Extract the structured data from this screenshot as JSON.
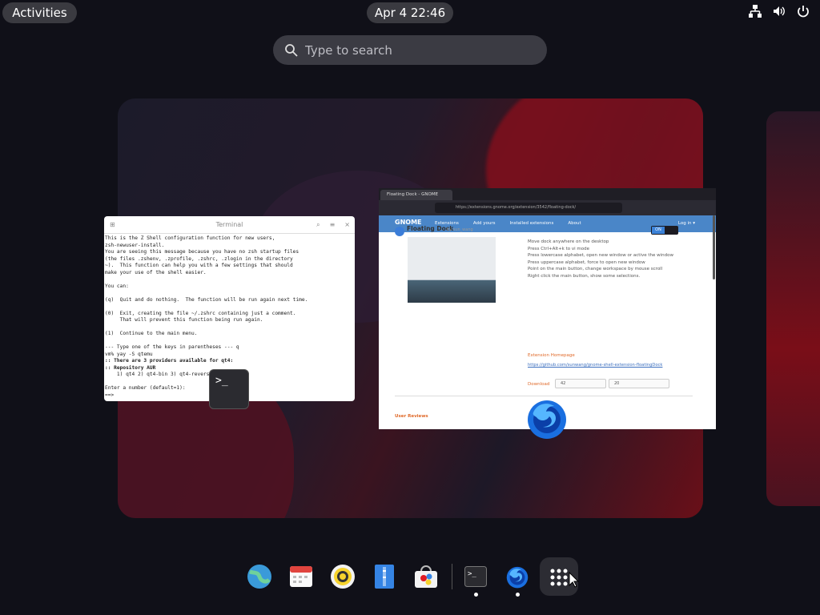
{
  "topbar": {
    "activities_label": "Activities",
    "clock": "Apr 4  22:46",
    "system_icons": [
      "network-icon",
      "volume-icon",
      "power-icon"
    ]
  },
  "search": {
    "placeholder": "Type to search"
  },
  "terminal_window": {
    "title": "Terminal",
    "lines": [
      "This is the Z Shell configuration function for new users,",
      "zsh-newuser-install.",
      "You are seeing this message because you have no zsh startup files",
      "(the files .zshenv, .zprofile, .zshrc, .zlogin in the directory",
      "~).  This function can help you with a few settings that should",
      "make your use of the shell easier.",
      "",
      "You can:",
      "",
      "(q)  Quit and do nothing.  The function will be run again next time.",
      "",
      "(0)  Exit, creating the file ~/.zshrc containing just a comment.",
      "     That will prevent this function being run again.",
      "",
      "(1)  Continue to the main menu.",
      "",
      "--- Type one of the keys in parentheses --- q",
      "vm% yay -S qtemu",
      ":: There are 3 providers available for qt4:",
      ":: Repository AUR",
      "    1) qt4 2) qt4-bin 3) qt4-reversion",
      "",
      "Enter a number (default=1):",
      "==> "
    ]
  },
  "firefox_window": {
    "tab_title": "Floating Dock - GNOME",
    "url": "https://extensions.gnome.org/extension/3542/floating-dock/",
    "site_logo": "GNOME",
    "nav_items": [
      "Extensions",
      "Add yours",
      "Installed extensions",
      "About"
    ],
    "login_label": "Log in ▾",
    "extension_name": "Floating Dock",
    "extension_author": "by sun_wang",
    "toggle_label": "ON",
    "description": [
      "Move dock anywhere on the desktop",
      "",
      "Press Ctrl+Alt+k to vi mode",
      "Press lowercase alphabet, open new window or active the window",
      "Press uppercase alphabet, force to open new window",
      "",
      "Point on the main button, change workspace by mouse scroll",
      "Right click the main button, show some selections."
    ],
    "homepage_label": "Extension Homepage",
    "homepage_url": "https://github.com/sunwang/gnome-shell-extension-floatingDock",
    "download_label": "Download",
    "shell_version": "42",
    "extension_version": "20",
    "reviews_label": "User Reviews"
  },
  "dock": {
    "items": [
      {
        "name": "web-browser-icon",
        "running": false
      },
      {
        "name": "calendar-icon",
        "running": false
      },
      {
        "name": "music-player-icon",
        "running": false
      },
      {
        "name": "text-editor-icon",
        "running": false
      },
      {
        "name": "software-store-icon",
        "running": false
      },
      {
        "name": "terminal-icon",
        "running": true
      },
      {
        "name": "firefox-icon",
        "running": true
      },
      {
        "name": "show-apps-icon",
        "running": false
      }
    ]
  },
  "colors": {
    "accent": "#3b82d8",
    "wallpaper_red": "#8b0f1c",
    "topbar_pill": "#3a3a40"
  }
}
